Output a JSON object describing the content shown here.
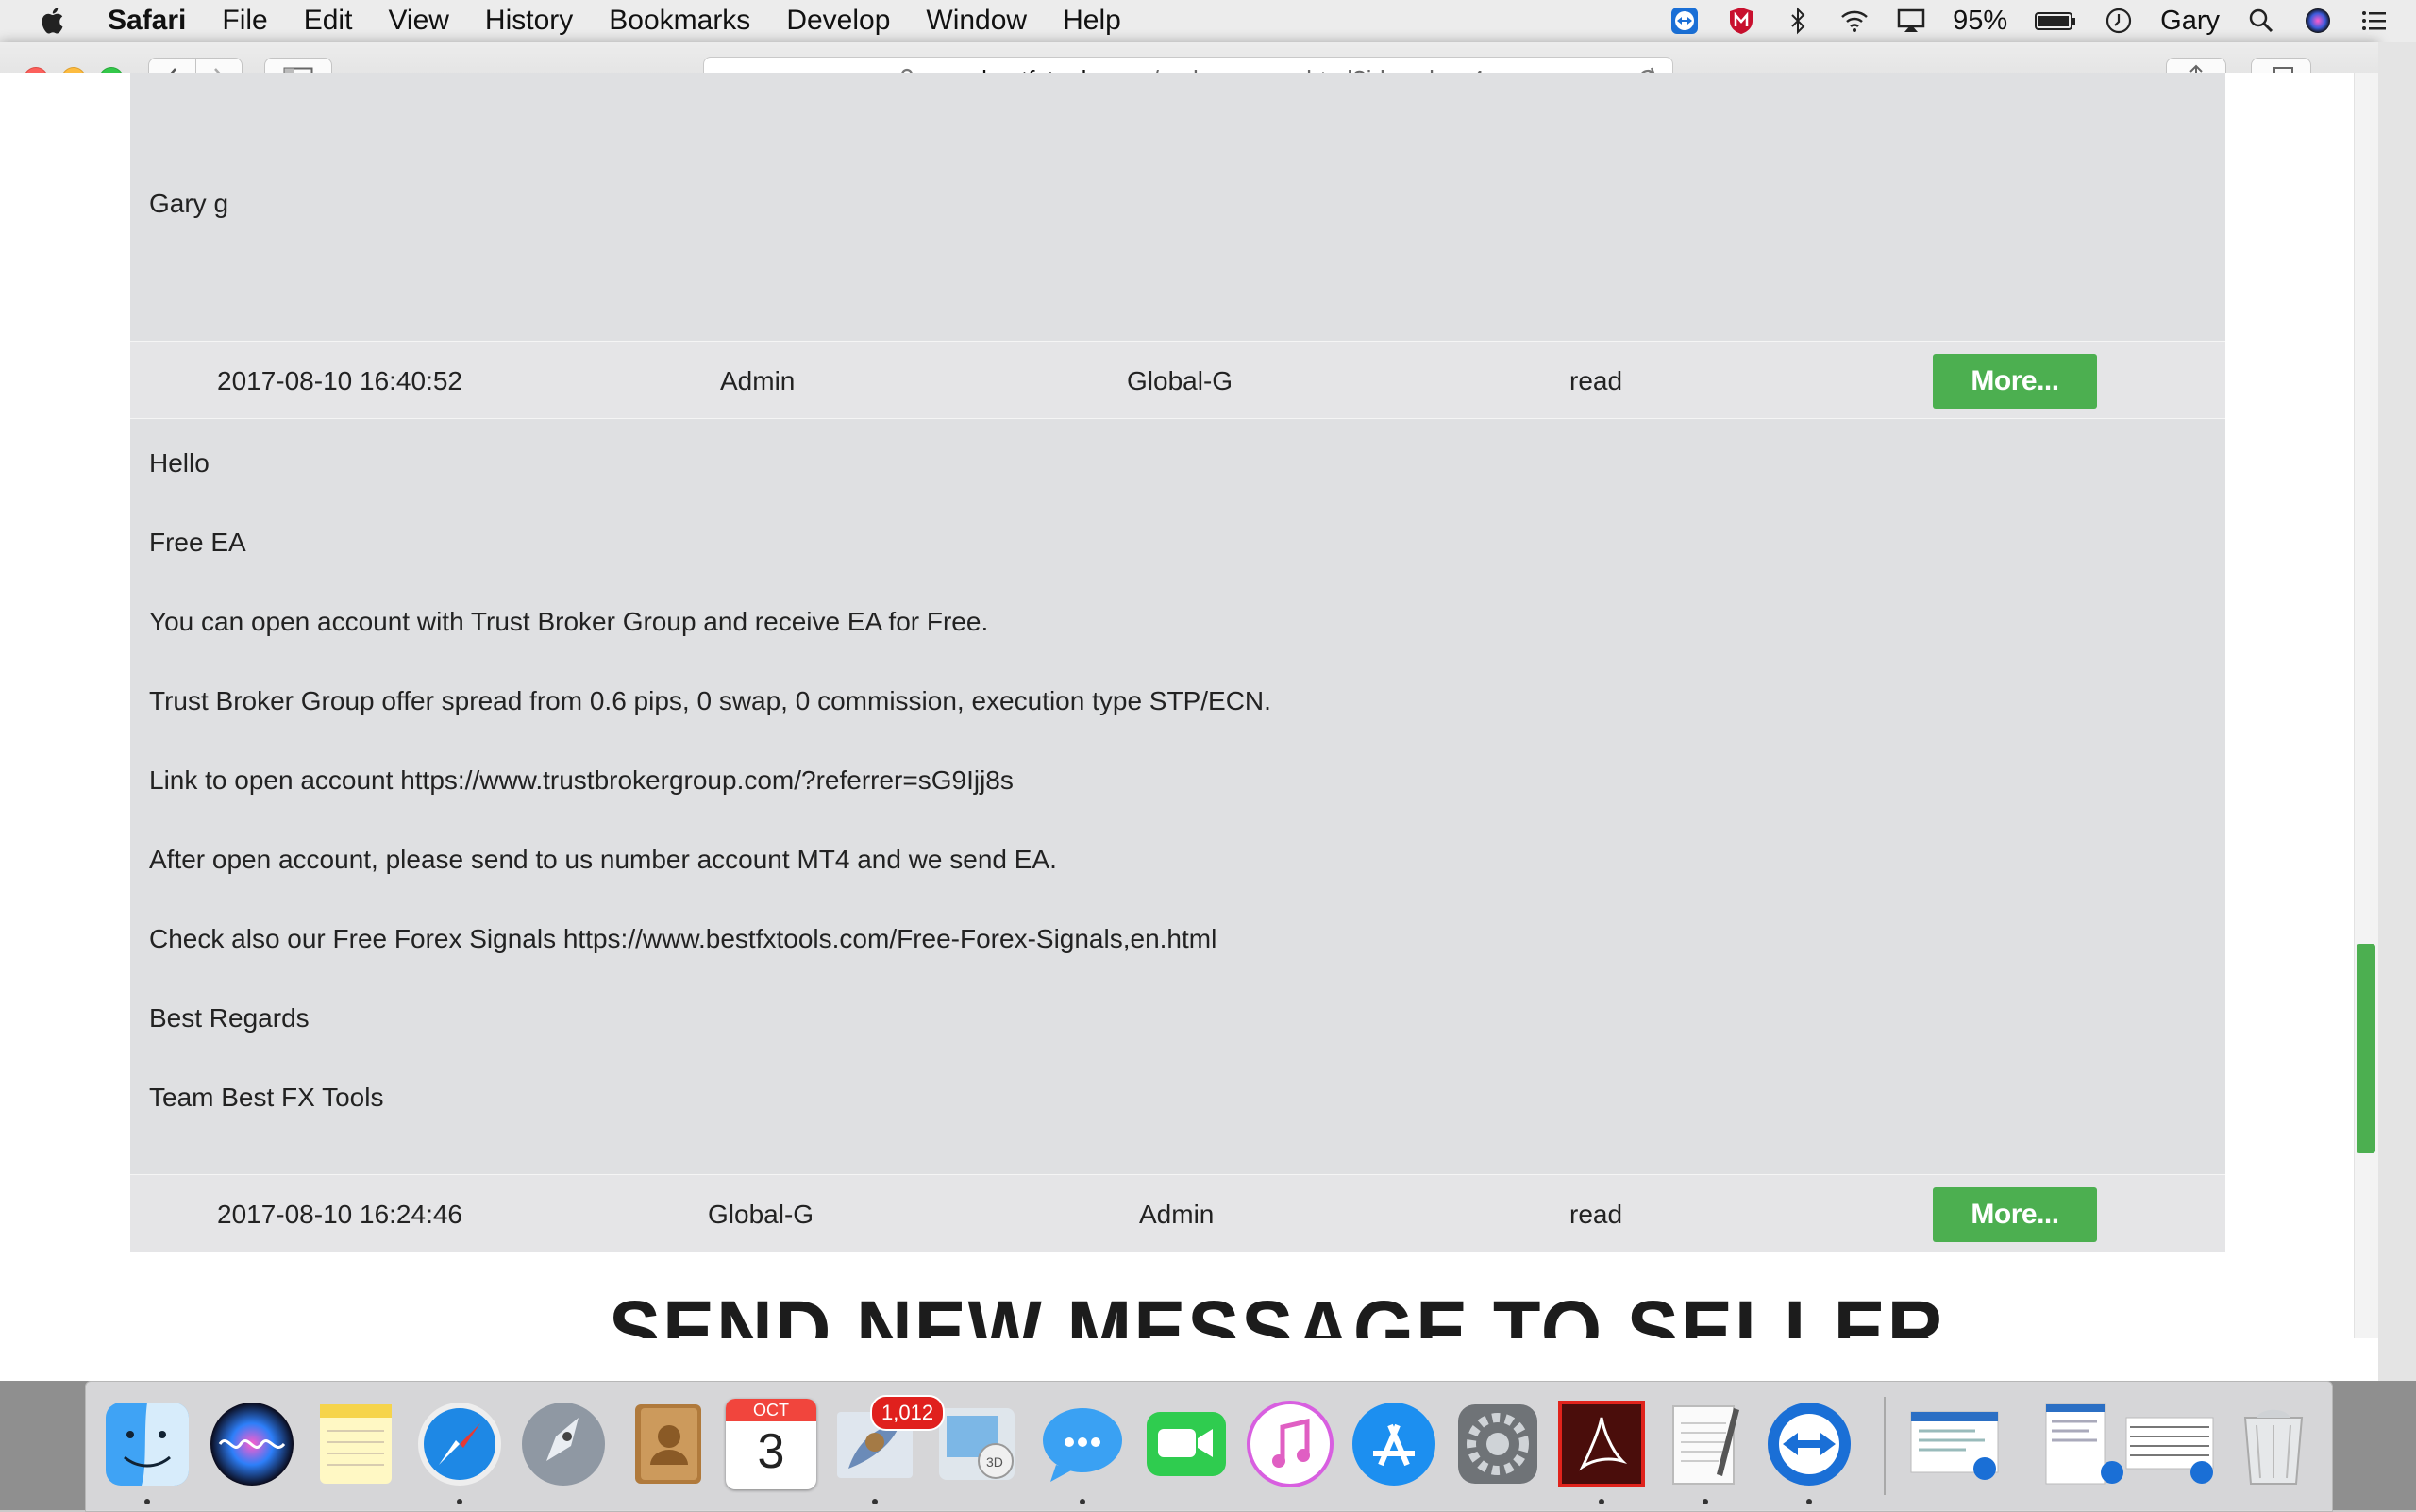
{
  "menubar": {
    "app": "Safari",
    "items": [
      "File",
      "Edit",
      "View",
      "History",
      "Bookmarks",
      "Develop",
      "Window",
      "Help"
    ],
    "battery": "95%",
    "user": "Gary"
  },
  "browser": {
    "url_host": "www.bestfxtools.com",
    "url_path": "/code,msg,en.html?id_order=4"
  },
  "messages": {
    "top_body": "Gary g",
    "row1": {
      "date": "2017-08-10 16:40:52",
      "from": "Admin",
      "to": "Global-G",
      "status": "read",
      "button": "More..."
    },
    "body_lines": [
      "Hello",
      "Free EA",
      "You can open account with Trust Broker Group and receive EA for Free.",
      "Trust Broker Group offer spread from 0.6 pips, 0 swap, 0 commission, execution type STP/ECN.",
      "Link to open account https://www.trustbrokergroup.com/?referrer=sG9Ijj8s",
      "After open account, please send to us number account MT4 and we send EA.",
      "Check also our Free Forex Signals https://www.bestfxtools.com/Free-Forex-Signals,en.html",
      "Best Regards",
      "Team Best FX Tools"
    ],
    "row2": {
      "date": "2017-08-10 16:24:46",
      "from": "Global-G",
      "to": "Admin",
      "status": "read",
      "button": "More..."
    }
  },
  "section_title": "SEND NEW MESSAGE TO SELLER",
  "dock": {
    "mail_badge": "1,012",
    "calendar_month": "OCT",
    "calendar_day": "3",
    "icons": [
      "finder-icon",
      "siri-icon",
      "notes-icon",
      "safari-icon",
      "launchpad-icon",
      "contacts-icon",
      "calendar-icon",
      "mail-icon",
      "maps-icon",
      "messages-icon",
      "facetime-icon",
      "itunes-icon",
      "app-store-icon",
      "system-preferences-icon",
      "acrobat-icon",
      "textedit-icon",
      "teamviewer-icon",
      "window-thumbnail-1",
      "window-thumbnail-2",
      "window-thumbnail-3",
      "trash-icon"
    ]
  },
  "colors": {
    "accent_green": "#4caf50",
    "message_bg": "#dfe0e2"
  }
}
